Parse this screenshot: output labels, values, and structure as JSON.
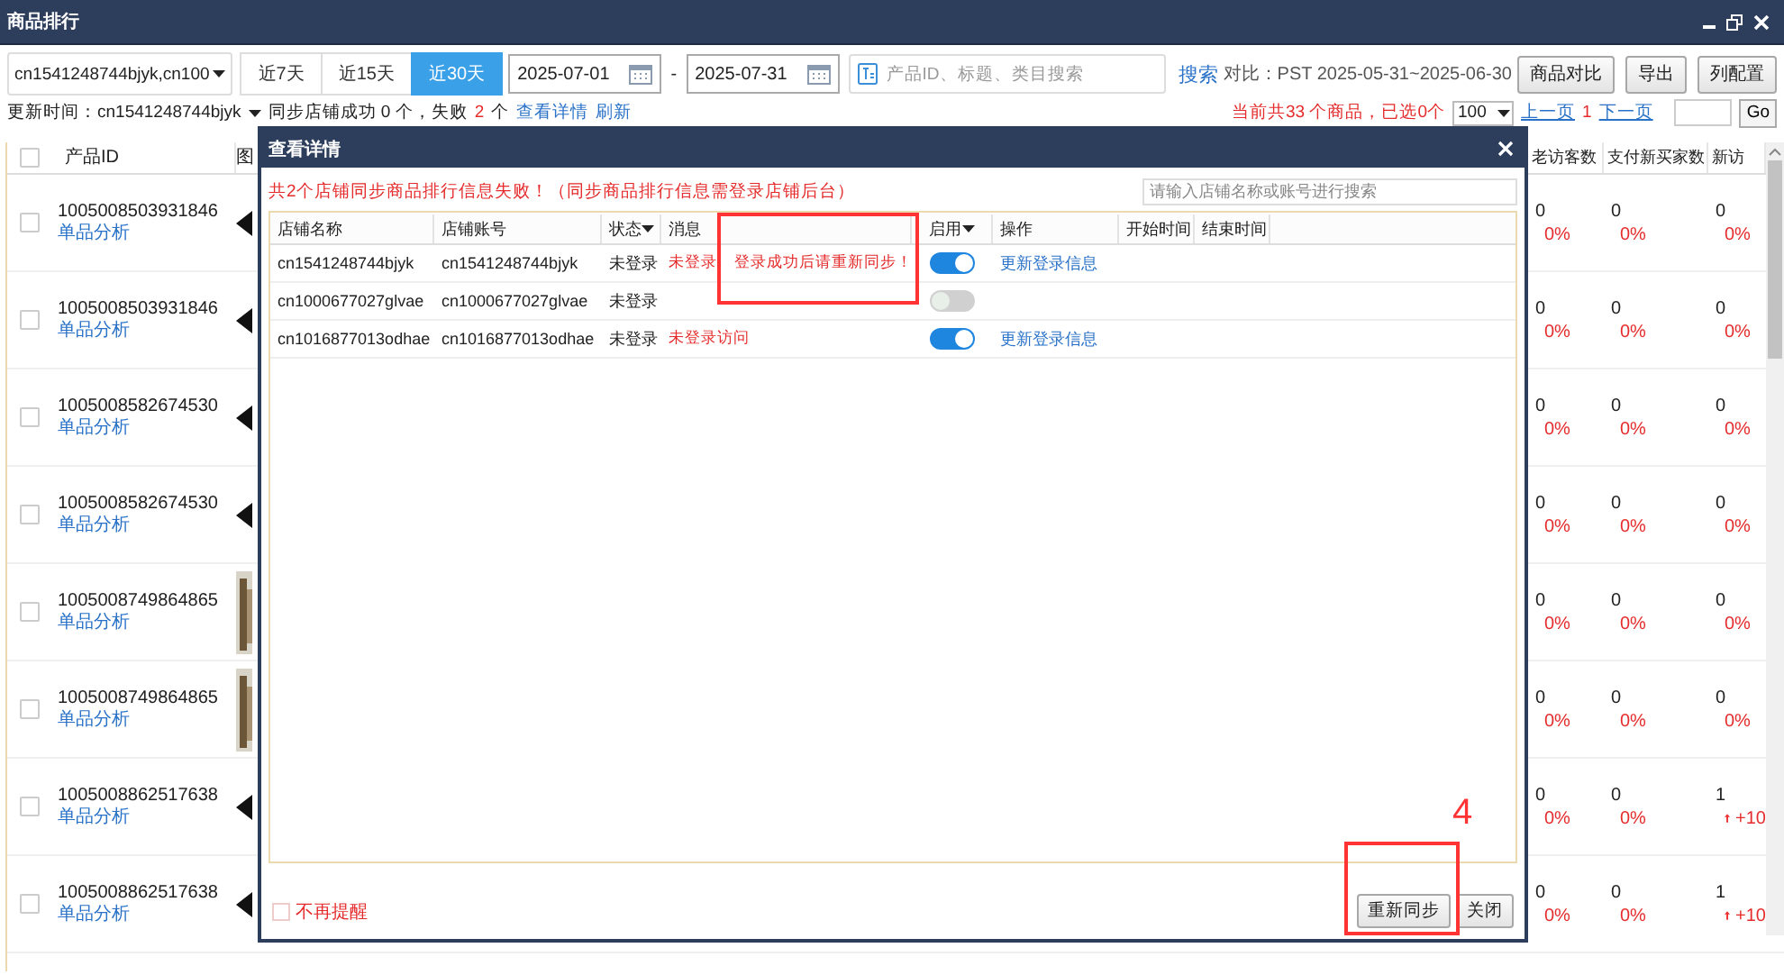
{
  "window": {
    "title": "商品排行"
  },
  "toolbar": {
    "shop_select": "cn1541248744bjyk,cn100",
    "ranges": [
      {
        "label": "近7天",
        "selected": false
      },
      {
        "label": "近15天",
        "selected": false
      },
      {
        "label": "近30天",
        "selected": true
      }
    ],
    "date_from": "2025-07-01",
    "date_separator": "-",
    "date_to": "2025-07-31",
    "search": {
      "placeholder": "产品ID、标题、类目搜索"
    },
    "search_link": "搜索",
    "compare": "对比：PST 2025-05-31~2025-06-30",
    "buttons": [
      "商品对比",
      "导出",
      "列配置"
    ]
  },
  "status_row": {
    "update_label": "更新时间：cn1541248744bjyk",
    "sync_text": "同步店铺成功 0 个，失败",
    "fail_count": "2",
    "sync_suffix": "个",
    "links": [
      "查看详情",
      "刷新"
    ],
    "summary": "当前共33 个商品，已选0个",
    "page_size": "100",
    "prev": "上一页",
    "page": "1",
    "next": "下一页",
    "go": "Go"
  },
  "table": {
    "select_all": {
      "checked": false
    },
    "columns_left": [
      "产品ID",
      "图"
    ],
    "columns_right": [
      "老访客数",
      "支付新买家数",
      "新访"
    ],
    "rows": [
      {
        "checked": false,
        "id": "1005008503931846",
        "link": "单品分析",
        "image": false,
        "metrics": [
          {
            "value": "0",
            "change": "0%",
            "kind": "flat"
          },
          {
            "value": "0",
            "change": "0%",
            "kind": "flat"
          },
          {
            "value": "0",
            "change": "0%",
            "kind": "flat"
          }
        ]
      },
      {
        "checked": false,
        "id": "1005008503931846",
        "link": "单品分析",
        "image": false,
        "metrics": [
          {
            "value": "0",
            "change": "0%",
            "kind": "flat"
          },
          {
            "value": "0",
            "change": "0%",
            "kind": "flat"
          },
          {
            "value": "0",
            "change": "0%",
            "kind": "flat"
          }
        ]
      },
      {
        "checked": false,
        "id": "1005008582674530",
        "link": "单品分析",
        "image": false,
        "metrics": [
          {
            "value": "0",
            "change": "0%",
            "kind": "flat"
          },
          {
            "value": "0",
            "change": "0%",
            "kind": "flat"
          },
          {
            "value": "0",
            "change": "0%",
            "kind": "flat"
          }
        ]
      },
      {
        "checked": false,
        "id": "1005008582674530",
        "link": "单品分析",
        "image": false,
        "metrics": [
          {
            "value": "0",
            "change": "0%",
            "kind": "flat"
          },
          {
            "value": "0",
            "change": "0%",
            "kind": "flat"
          },
          {
            "value": "0",
            "change": "0%",
            "kind": "flat"
          }
        ]
      },
      {
        "checked": false,
        "id": "1005008749864865",
        "link": "单品分析",
        "image": true,
        "metrics": [
          {
            "value": "0",
            "change": "0%",
            "kind": "flat"
          },
          {
            "value": "0",
            "change": "0%",
            "kind": "flat"
          },
          {
            "value": "0",
            "change": "0%",
            "kind": "flat"
          }
        ]
      },
      {
        "checked": false,
        "id": "1005008749864865",
        "link": "单品分析",
        "image": true,
        "metrics": [
          {
            "value": "0",
            "change": "0%",
            "kind": "flat"
          },
          {
            "value": "0",
            "change": "0%",
            "kind": "flat"
          },
          {
            "value": "0",
            "change": "0%",
            "kind": "flat"
          }
        ]
      },
      {
        "checked": false,
        "id": "1005008862517638",
        "link": "单品分析",
        "image": false,
        "metrics": [
          {
            "value": "0",
            "change": "0%",
            "kind": "flat"
          },
          {
            "value": "0",
            "change": "0%",
            "kind": "flat"
          },
          {
            "value": "1",
            "change": "+10",
            "kind": "up"
          }
        ]
      },
      {
        "checked": false,
        "id": "1005008862517638",
        "link": "单品分析",
        "image": false,
        "metrics": [
          {
            "value": "0",
            "change": "0%",
            "kind": "flat"
          },
          {
            "value": "0",
            "change": "0%",
            "kind": "flat"
          },
          {
            "value": "1",
            "change": "+10",
            "kind": "up"
          }
        ]
      }
    ]
  },
  "dialog": {
    "title": "查看详情",
    "error": "共2个店铺同步商品排行信息失败！（同步商品排行信息需登录店铺后台）",
    "search": {
      "placeholder": "请输入店铺名称或账号进行搜索"
    },
    "columns": [
      {
        "label": "店铺名称",
        "filter": false
      },
      {
        "label": "店铺账号",
        "filter": false
      },
      {
        "label": "状态",
        "filter": true
      },
      {
        "label": "消息",
        "filter": false
      },
      {
        "label": "启用",
        "filter": true
      },
      {
        "label": "操作",
        "filter": false
      },
      {
        "label": "开始时间",
        "filter": false
      },
      {
        "label": "结束时间",
        "filter": false
      }
    ],
    "rows": [
      {
        "name": "cn1541248744bjyk",
        "account": "cn1541248744bjyk",
        "status": "未登录",
        "message": "未登录 登录成功后请重新同步！",
        "enabled": true,
        "action": "更新登录信息"
      },
      {
        "name": "cn1000677027glvae",
        "account": "cn1000677027glvae",
        "status": "未登录",
        "enabled": false
      },
      {
        "name": "cn1016877013odhae",
        "account": "cn1016877013odhae",
        "status": "未登录",
        "message": "未登录访问",
        "enabled": true,
        "action": "更新登录信息"
      }
    ],
    "remind": {
      "label": "不再提醒",
      "checked": false
    },
    "buttons": [
      "重新同步",
      "关闭"
    ]
  },
  "annotations": {
    "number": "4"
  }
}
